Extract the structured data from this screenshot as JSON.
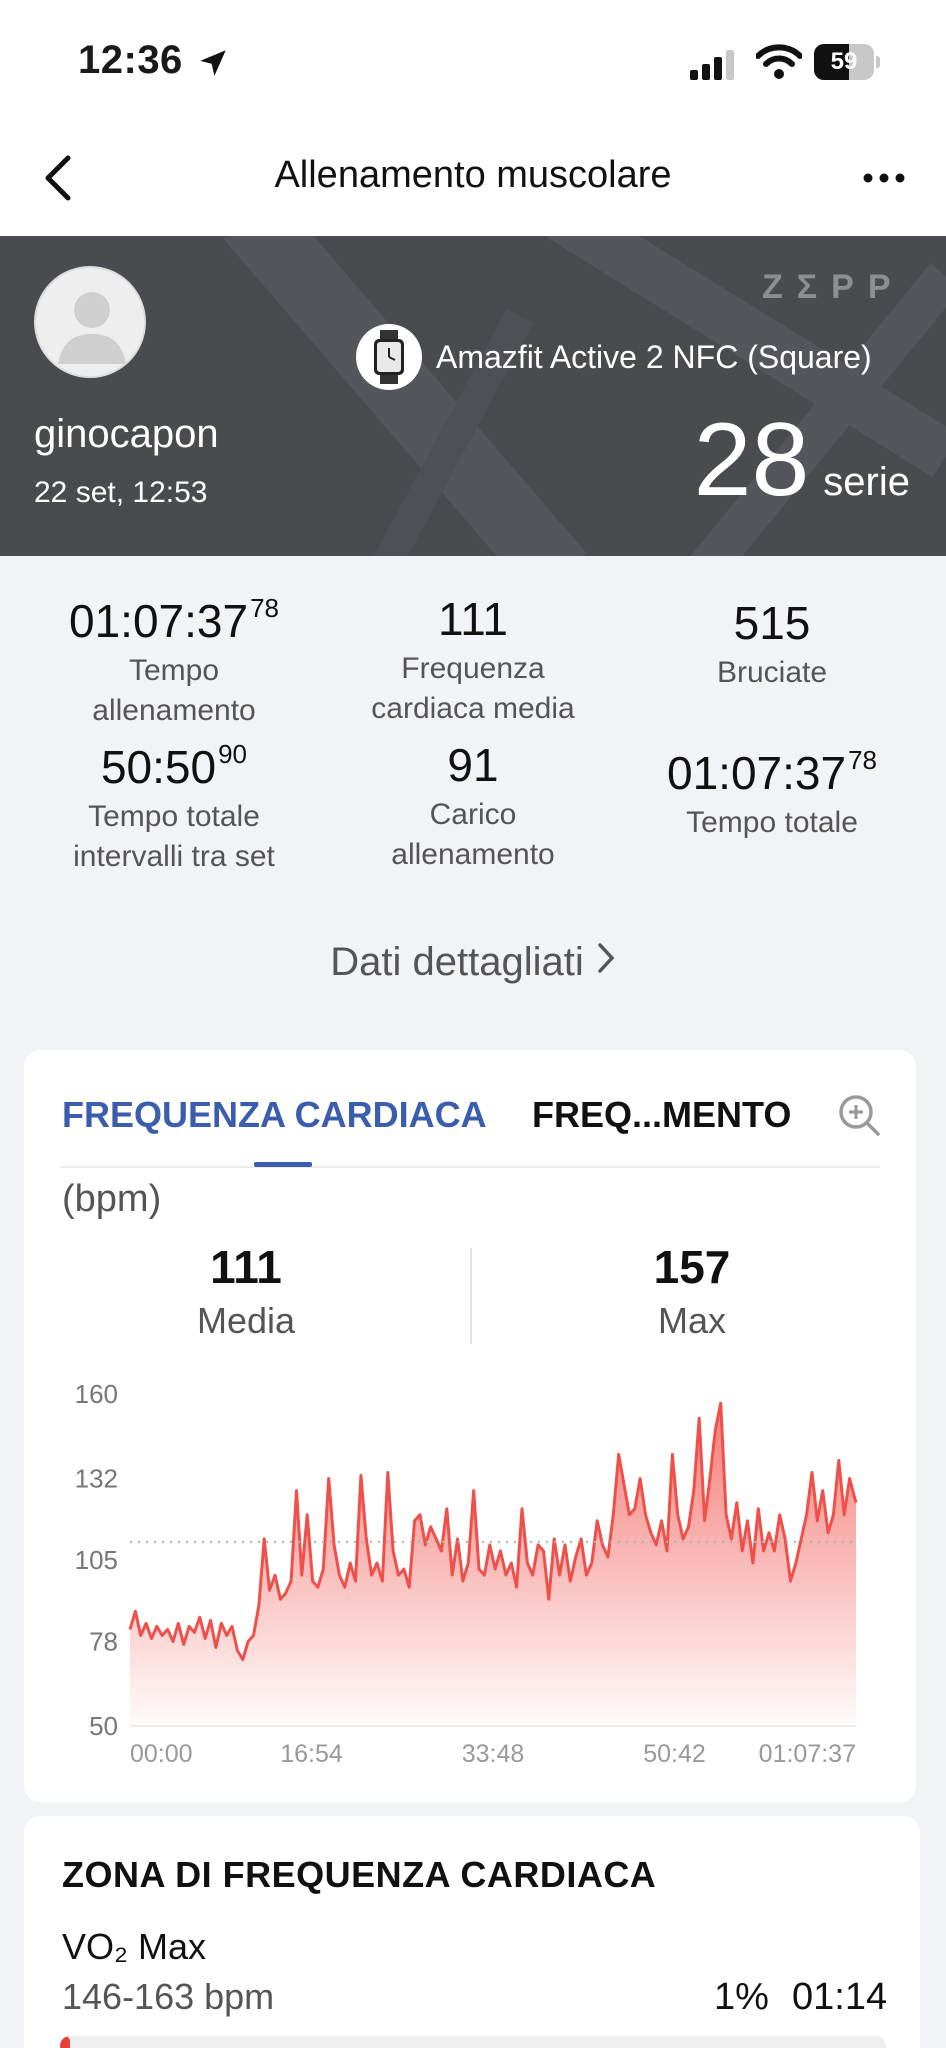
{
  "status_bar": {
    "time": "12:36",
    "battery": "59",
    "battery_level": 0.59
  },
  "nav": {
    "title": "Allenamento muscolare"
  },
  "hero": {
    "brand": "ZΣPP",
    "username": "ginocapon",
    "datetime": "22 set, 12:53",
    "device": "Amazfit Active 2 NFC (Square)",
    "series_count": "28",
    "series_unit": "serie"
  },
  "stats": [
    {
      "value": "01:07:37",
      "sup": "78",
      "label": "Tempo allenamento"
    },
    {
      "value": "111",
      "sup": "",
      "label": "Frequenza cardiaca media"
    },
    {
      "value": "515",
      "sup": "",
      "label": "Bruciate"
    },
    {
      "value": "50:50",
      "sup": "90",
      "label": "Tempo totale intervalli tra set"
    },
    {
      "value": "91",
      "sup": "",
      "label": "Carico allenamento"
    },
    {
      "value": "01:07:37",
      "sup": "78",
      "label": "Tempo totale"
    }
  ],
  "detail_link": "Dati dettagliati",
  "card": {
    "tabs": [
      "FREQUENZA CARDIACA",
      "FREQ...MENTO"
    ],
    "unit": "(bpm)",
    "summary": [
      {
        "value": "111",
        "label": "Media"
      },
      {
        "value": "157",
        "label": "Max"
      }
    ]
  },
  "chart_data": {
    "type": "area",
    "title": "",
    "xlabel": "",
    "ylabel": "(bpm)",
    "ylim": [
      50,
      160
    ],
    "yticks": [
      "160",
      "132",
      "105",
      "78",
      "50"
    ],
    "xticks": [
      "00:00",
      "16:54",
      "33:48",
      "50:42",
      "01:07:37"
    ],
    "average_line": 111,
    "color": "#f0504a",
    "x_minutes": [
      0,
      0.5,
      1,
      1.5,
      2,
      2.5,
      3,
      3.5,
      4,
      4.5,
      5,
      5.5,
      6,
      6.5,
      7,
      7.5,
      8,
      8.5,
      9,
      9.5,
      10,
      10.5,
      11,
      11.5,
      12,
      12.5,
      13,
      13.5,
      14,
      14.5,
      15,
      15.5,
      16,
      16.5,
      17,
      17.5,
      18,
      18.5,
      19,
      19.5,
      20,
      20.5,
      21,
      21.5,
      22,
      22.5,
      23,
      23.5,
      24,
      24.5,
      25,
      25.5,
      26,
      26.5,
      27,
      27.5,
      28,
      28.5,
      29,
      29.5,
      30,
      30.5,
      31,
      31.5,
      32,
      32.5,
      33,
      33.5,
      34,
      34.5,
      35,
      35.5,
      36,
      36.5,
      37,
      37.5,
      38,
      38.5,
      39,
      39.5,
      40,
      40.5,
      41,
      41.5,
      42,
      42.5,
      43,
      43.5,
      44,
      44.5,
      45,
      45.5,
      46,
      46.5,
      47,
      47.5,
      48,
      48.5,
      49,
      49.5,
      50,
      50.5,
      51,
      51.5,
      52,
      52.5,
      53,
      53.5,
      54,
      54.5,
      55,
      55.5,
      56,
      56.5,
      57,
      57.5,
      58,
      58.5,
      59,
      59.5,
      60,
      60.5,
      61,
      61.5,
      62,
      62.5,
      63,
      63.5,
      64,
      64.5,
      65,
      65.5,
      66,
      66.5,
      67,
      67.6
    ],
    "bpm": [
      82,
      88,
      80,
      84,
      79,
      83,
      80,
      82,
      78,
      84,
      77,
      83,
      81,
      86,
      79,
      85,
      76,
      84,
      80,
      83,
      75,
      72,
      78,
      80,
      90,
      112,
      95,
      100,
      92,
      94,
      98,
      128,
      100,
      120,
      98,
      96,
      102,
      132,
      110,
      100,
      96,
      104,
      98,
      133,
      112,
      100,
      104,
      98,
      134,
      108,
      100,
      102,
      96,
      118,
      120,
      110,
      116,
      112,
      108,
      122,
      100,
      112,
      98,
      104,
      128,
      102,
      100,
      110,
      102,
      108,
      100,
      104,
      96,
      122,
      104,
      100,
      110,
      108,
      92,
      112,
      100,
      110,
      98,
      106,
      112,
      100,
      104,
      118,
      110,
      106,
      120,
      140,
      130,
      120,
      122,
      132,
      120,
      114,
      110,
      118,
      108,
      140,
      120,
      112,
      116,
      128,
      152,
      118,
      132,
      148,
      157,
      120,
      112,
      124,
      108,
      118,
      104,
      122,
      108,
      114,
      108,
      120,
      112,
      98,
      104,
      112,
      120,
      134,
      118,
      128,
      114,
      120,
      138,
      120,
      132,
      124,
      140,
      122,
      118,
      128
    ]
  },
  "zone_card": {
    "title": "ZONA DI FREQUENZA CARDIACA",
    "zone_name": "VO₂ Max",
    "zone_range": "146-163 bpm",
    "zone_pct": "1%",
    "zone_time": "01:14",
    "zone_fraction": 0.01
  }
}
